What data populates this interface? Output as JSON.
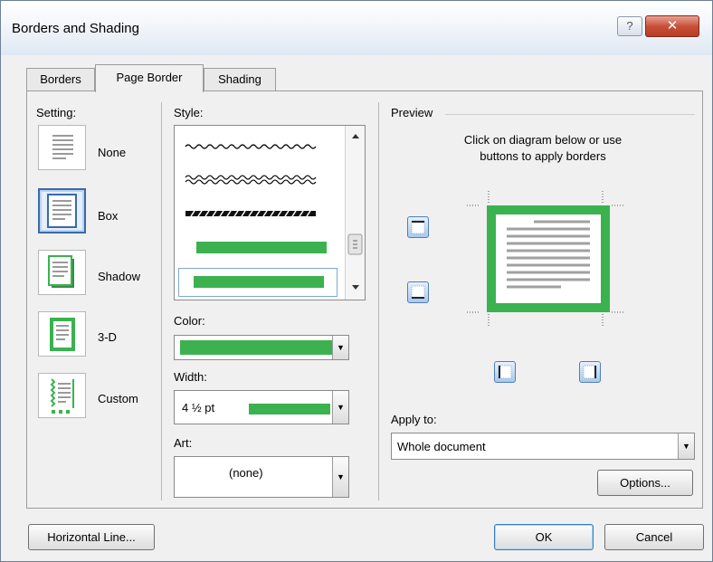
{
  "window": {
    "title": "Borders and Shading",
    "help_glyph": "?",
    "close_glyph": "✕"
  },
  "tabs": [
    {
      "label": "Borders",
      "active": false
    },
    {
      "label": "Page Border",
      "active": true
    },
    {
      "label": "Shading",
      "active": false
    }
  ],
  "setting": {
    "header": "Setting:",
    "options": [
      {
        "label": "None",
        "icon": "setting-none-icon",
        "selected": false
      },
      {
        "label": "Box",
        "icon": "setting-box-icon",
        "selected": true
      },
      {
        "label": "Shadow",
        "icon": "setting-shadow-icon",
        "selected": false
      },
      {
        "label": "3-D",
        "icon": "setting-3d-icon",
        "selected": false
      },
      {
        "label": "Custom",
        "icon": "setting-custom-icon",
        "selected": false
      }
    ]
  },
  "style": {
    "header": "Style:",
    "items": [
      "wavy-line",
      "double-wavy-line",
      "dash-dot-stroked",
      "thick-green",
      "thick-green-selected"
    ]
  },
  "color": {
    "header": "Color:",
    "value": "#3bb24f"
  },
  "width": {
    "header": "Width:",
    "value": "4 ½ pt"
  },
  "art": {
    "header": "Art:",
    "value": "(none)"
  },
  "preview": {
    "header": "Preview",
    "instruction_line1": "Click on diagram below or use",
    "instruction_line2": "buttons to apply borders"
  },
  "apply_to": {
    "header": "Apply to:",
    "value": "Whole document"
  },
  "buttons": {
    "options": "Options...",
    "horizontal_line": "Horizontal Line...",
    "ok": "OK",
    "cancel": "Cancel"
  },
  "colors": {
    "accent_green": "#3bb24f",
    "selection_blue": "#3a6aa8"
  }
}
